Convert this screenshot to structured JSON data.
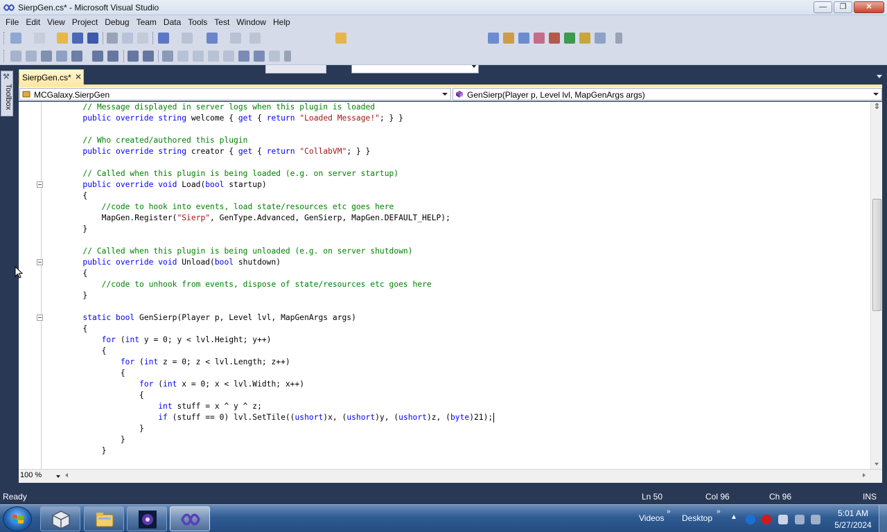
{
  "window": {
    "title": "SierpGen.cs* - Microsoft Visual Studio"
  },
  "menu": [
    "File",
    "Edit",
    "View",
    "Project",
    "Debug",
    "Team",
    "Data",
    "Tools",
    "Test",
    "Window",
    "Help"
  ],
  "toolbox": {
    "label": "Toolbox"
  },
  "document_tab": {
    "label": "SierpGen.cs*",
    "close": "✕"
  },
  "navigation": {
    "type_combo": "MCGalaxy.SierpGen",
    "member_combo": "GenSierp(Player p, Level lvl, MapGenArgs args)"
  },
  "code_lines": [
    [
      [
        "cm",
        "        // Message displayed in server logs when this plugin is loaded"
      ]
    ],
    [
      [
        "kw",
        "        public override string"
      ],
      [
        "tx",
        " welcome { "
      ],
      [
        "kw",
        "get"
      ],
      [
        "tx",
        " { "
      ],
      [
        "kw",
        "return"
      ],
      [
        "tx",
        " "
      ],
      [
        "st",
        "\"Loaded Message!\""
      ],
      [
        "tx",
        "; } }"
      ]
    ],
    [],
    [
      [
        "cm",
        "        // Who created/authored this plugin"
      ]
    ],
    [
      [
        "kw",
        "        public override string"
      ],
      [
        "tx",
        " creator { "
      ],
      [
        "kw",
        "get"
      ],
      [
        "tx",
        " { "
      ],
      [
        "kw",
        "return"
      ],
      [
        "tx",
        " "
      ],
      [
        "st",
        "\"CollabVM\""
      ],
      [
        "tx",
        "; } }"
      ]
    ],
    [],
    [
      [
        "cm",
        "        // Called when this plugin is being loaded (e.g. on server startup)"
      ]
    ],
    [
      [
        "kw",
        "        public override void"
      ],
      [
        "tx",
        " Load("
      ],
      [
        "kw",
        "bool"
      ],
      [
        "tx",
        " startup)"
      ]
    ],
    [
      [
        "tx",
        "        {"
      ]
    ],
    [
      [
        "cm",
        "            //code to hook into events, load state/resources etc goes here"
      ]
    ],
    [
      [
        "tx",
        "            MapGen.Register("
      ],
      [
        "st",
        "\"Sierp\""
      ],
      [
        "tx",
        ", GenType.Advanced, GenSierp, MapGen.DEFAULT_HELP);"
      ]
    ],
    [
      [
        "tx",
        "        }"
      ]
    ],
    [],
    [
      [
        "cm",
        "        // Called when this plugin is being unloaded (e.g. on server shutdown)"
      ]
    ],
    [
      [
        "kw",
        "        public override void"
      ],
      [
        "tx",
        " Unload("
      ],
      [
        "kw",
        "bool"
      ],
      [
        "tx",
        " shutdown)"
      ]
    ],
    [
      [
        "tx",
        "        {"
      ]
    ],
    [
      [
        "cm",
        "            //code to unhook from events, dispose of state/resources etc goes here"
      ]
    ],
    [
      [
        "tx",
        "        }"
      ]
    ],
    [],
    [
      [
        "kw",
        "        static bool"
      ],
      [
        "tx",
        " GenSierp(Player p, Level lvl, MapGenArgs args)"
      ]
    ],
    [
      [
        "tx",
        "        {"
      ]
    ],
    [
      [
        "kw",
        "            for"
      ],
      [
        "tx",
        " ("
      ],
      [
        "kw",
        "int"
      ],
      [
        "tx",
        " y = 0; y < lvl.Height; y++)"
      ]
    ],
    [
      [
        "tx",
        "            {"
      ]
    ],
    [
      [
        "kw",
        "                for"
      ],
      [
        "tx",
        " ("
      ],
      [
        "kw",
        "int"
      ],
      [
        "tx",
        " z = 0; z < lvl.Length; z++)"
      ]
    ],
    [
      [
        "tx",
        "                {"
      ]
    ],
    [
      [
        "kw",
        "                    for"
      ],
      [
        "tx",
        " ("
      ],
      [
        "kw",
        "int"
      ],
      [
        "tx",
        " x = 0; x < lvl.Width; x++)"
      ]
    ],
    [
      [
        "tx",
        "                    {"
      ]
    ],
    [
      [
        "kw",
        "                        int"
      ],
      [
        "tx",
        " stuff = x ^ y ^ z;"
      ]
    ],
    [
      [
        "kw",
        "                        if"
      ],
      [
        "tx",
        " (stuff == 0) lvl.SetTile(("
      ],
      [
        "kw",
        "ushort"
      ],
      [
        "tx",
        ")x, ("
      ],
      [
        "kw",
        "ushort"
      ],
      [
        "tx",
        ")y, ("
      ],
      [
        "kw",
        "ushort"
      ],
      [
        "tx",
        ")z, ("
      ],
      [
        "kw",
        "byte"
      ],
      [
        "tx",
        ")21);"
      ]
    ],
    [
      [
        "tx",
        "                    }"
      ]
    ],
    [
      [
        "tx",
        "                }"
      ]
    ],
    [
      [
        "tx",
        "            }"
      ]
    ]
  ],
  "editor": {
    "zoom": "100 %"
  },
  "status": {
    "state": "Ready",
    "line": "Ln 50",
    "col": "Col 96",
    "ch": "Ch 96",
    "mode": "INS"
  },
  "taskbar": {
    "toolbars": [
      "Videos",
      "Desktop"
    ],
    "time": "5:01 AM",
    "date": "5/27/2024"
  },
  "colors": {
    "comment": "#008000",
    "keyword": "#0000ff",
    "string": "#a31515",
    "chrome": "#293955"
  }
}
